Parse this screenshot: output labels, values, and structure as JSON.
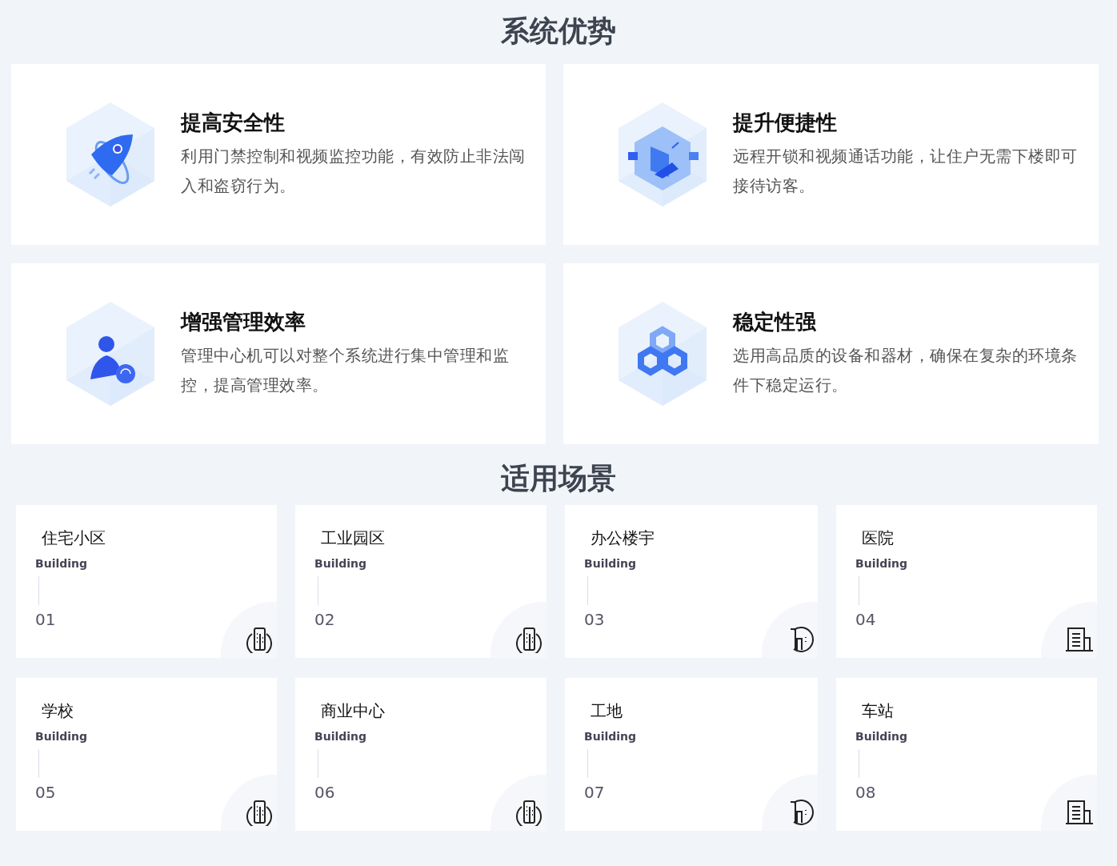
{
  "advantages": {
    "title": "系统优势",
    "items": [
      {
        "kind": "rocket",
        "title": "提高安全性",
        "description": "利用门禁控制和视频监控功能，有效防止非法闯入和盗窃行为。"
      },
      {
        "kind": "cube",
        "title": "提升便捷性",
        "description": "远程开锁和视频通话功能，让住户无需下楼即可接待访客。"
      },
      {
        "kind": "user",
        "title": "增强管理效率",
        "description": "管理中心机可以对整个系统进行集中管理和监控，提高管理效率。"
      },
      {
        "kind": "hexagons",
        "title": "稳定性强",
        "description": "选用高品质的设备和器材，确保在复杂的环境条件下稳定运行。"
      }
    ]
  },
  "scenarios": {
    "title": "适用场景",
    "items": [
      {
        "kind": "tower",
        "name": "住宅小区",
        "subtitle": "Building",
        "number": "01"
      },
      {
        "kind": "tower",
        "name": "工业园区",
        "subtitle": "Building",
        "number": "02"
      },
      {
        "kind": "hbuilding",
        "name": "办公楼宇",
        "subtitle": "Building",
        "number": "03"
      },
      {
        "kind": "office",
        "name": "医院",
        "subtitle": "Building",
        "number": "04"
      },
      {
        "kind": "tower",
        "name": "学校",
        "subtitle": "Building",
        "number": "05"
      },
      {
        "kind": "tower",
        "name": "商业中心",
        "subtitle": "Building",
        "number": "06"
      },
      {
        "kind": "hbuilding",
        "name": "工地",
        "subtitle": "Building",
        "number": "07"
      },
      {
        "kind": "office",
        "name": "车站",
        "subtitle": "Building",
        "number": "08"
      }
    ]
  }
}
